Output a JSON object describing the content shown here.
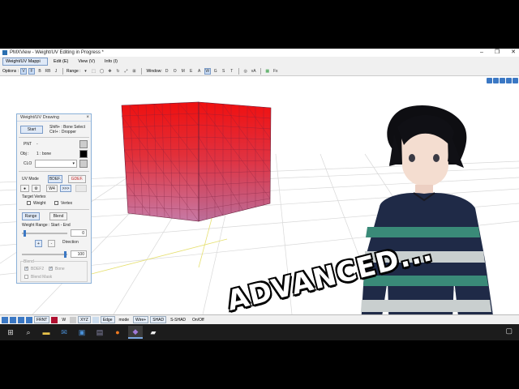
{
  "window": {
    "title": "PMXView - Weight/UV Editing in Progress *",
    "controls": [
      "–",
      "❐",
      "✕"
    ]
  },
  "menu": {
    "mode_dropdown": "Weight/UV Mappi",
    "items": [
      "Edit (E)",
      "View (V)",
      "Info (I)"
    ]
  },
  "toolbar": {
    "options_label": "Options :",
    "options_buttons": [
      "V",
      "F",
      "B",
      "RB",
      "J"
    ],
    "range_label": "Range :",
    "window_label": "Window:",
    "window_buttons": [
      "D",
      "O",
      "M",
      "E",
      "A",
      "W",
      "G",
      "S",
      "T"
    ],
    "extra": [
      "vA",
      "Fx"
    ]
  },
  "panel": {
    "title": "Weight/UV Drawing",
    "close": "×",
    "start_label": "Start",
    "shift_hint": "Shift+ : Bone Select",
    "ctrl_hint": "Ctrl+ : Dropper",
    "pnt_label": "PNT",
    "pnt_value": "-",
    "obj_label": "Obj :",
    "obj_value": "1 : bone",
    "clo_label": "CLO",
    "uv_mode_label": "UV Mode",
    "bdef_label": "BDEF.",
    "gdef_label": "GDEF.",
    "w4_label": "W4",
    "arrow_label": ">>>",
    "target_vertex_label": "Target Vertex",
    "weight_label": "Weight",
    "vertex_label": "Vertex",
    "range_label": "Range",
    "blend_label": "Blend",
    "weight_range_label": "Weight Range : Start - End",
    "start_value": "0",
    "plus_label": "+",
    "minus_label": "-",
    "direction_label": "Direction",
    "direction_value": "100",
    "blend_group_label": "Blend",
    "bdef2_label": "BDEF2",
    "bone_label": "Bone",
    "blend_mask_label": "Blend Mask"
  },
  "overlay": {
    "text": "ADVANCED..."
  },
  "statusbar": {
    "items": [
      "FRNT",
      "W",
      "XYZ",
      "Edge",
      "mode",
      "Wire+",
      "SHAD",
      "S-SHAD",
      "On/Off"
    ]
  },
  "taskbar": {
    "icons": [
      "windows-start-icon",
      "search-icon",
      "file-explorer-icon",
      "mail-icon",
      "store-icon",
      "app-icon",
      "firefox-icon",
      "pmxview-icon",
      "folder-icon"
    ],
    "tray_icon": "notification-icon"
  },
  "colors": {
    "cube_top": "#ee1111",
    "cube_bottom": "#c85a8a",
    "accent": "#7a9bc8",
    "taskbar": "#1c1c1c"
  }
}
